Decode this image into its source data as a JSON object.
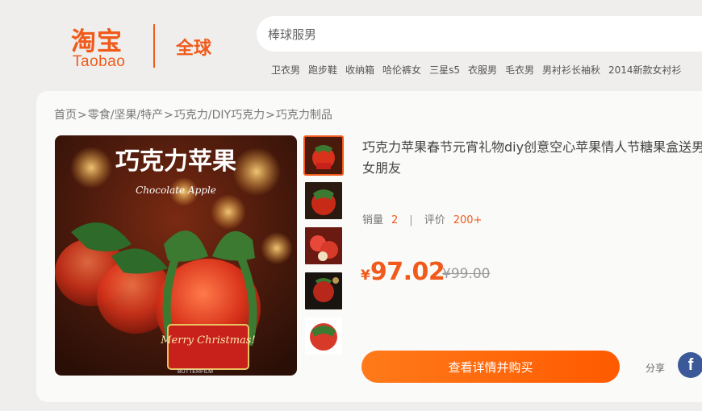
{
  "header": {
    "logo_cn": "淘宝",
    "logo_en": "Taobao",
    "logo_global": "全球",
    "search_placeholder": "棒球服男",
    "hot_words": [
      "卫衣男",
      "跑步鞋",
      "收纳箱",
      "哈伦裤女",
      "三星s5",
      "衣服男",
      "毛衣男",
      "男衬衫长袖秋",
      "2014新款女衬衫"
    ]
  },
  "breadcrumb": [
    "首页",
    "零食/坚果/特产",
    "巧克力/DIY巧克力",
    "巧克力制品"
  ],
  "breadcrumb_sep": ">",
  "product": {
    "image_title": "巧克力苹果",
    "image_subtitle": "Chocolate Apple",
    "image_tag": "Merry Christmas!",
    "image_brand": "BUTTERFILM",
    "title": "巧克力苹果春节元宵礼物diy创意空心苹果情人节糖果盒送男女朋友",
    "sales_label": "销量",
    "sales_value": "2",
    "reviews_label": "评价",
    "reviews_value": "200+",
    "currency": "¥",
    "price": "97.02",
    "original_price": "¥99.00",
    "buy_label": "查看详情并购买",
    "share_label": "分享",
    "thumb_count": 5
  },
  "colors": {
    "accent": "#f05a1a",
    "facebook": "#3b5998"
  },
  "icons": {
    "share": "facebook-icon"
  }
}
